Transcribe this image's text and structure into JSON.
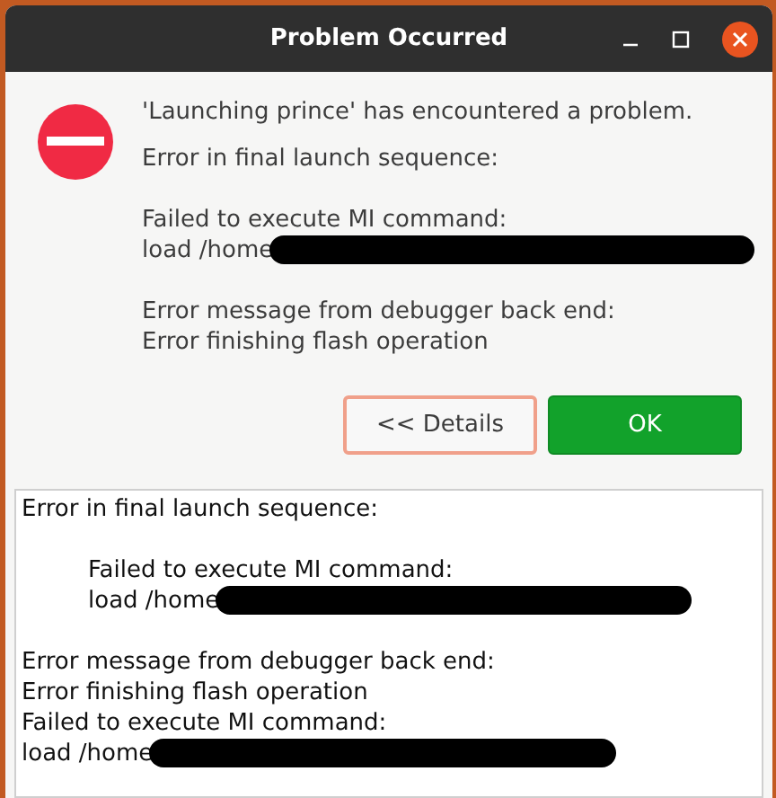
{
  "window": {
    "title": "Problem Occurred"
  },
  "message": {
    "headline": "'Launching prince' has encountered a problem.",
    "paragraphs": [
      {
        "lines": [
          {
            "text": "Error in final launch sequence:",
            "redacted": false
          }
        ]
      },
      {
        "lines": [
          {
            "text": "Failed to execute MI command:",
            "redacted": false
          },
          {
            "text": "load /home",
            "redacted": true
          }
        ]
      },
      {
        "lines": [
          {
            "text": "Error message from debugger back end:",
            "redacted": false
          },
          {
            "text": "Error finishing flash operation",
            "redacted": false
          }
        ]
      }
    ]
  },
  "buttons": [
    {
      "label": "<< Details",
      "kind": "secondary"
    },
    {
      "label": "OK",
      "kind": "primary"
    }
  ],
  "details": {
    "paragraphs": [
      {
        "indented": false,
        "lines": [
          {
            "text": "Error in final launch sequence:",
            "redacted": false
          }
        ]
      },
      {
        "indented": true,
        "lines": [
          {
            "text": "Failed to execute MI command:",
            "redacted": false
          },
          {
            "text": "load /home",
            "redacted": true
          }
        ]
      },
      {
        "indented": false,
        "lines": [
          {
            "text": "Error message from debugger back end:",
            "redacted": false
          },
          {
            "text": "Error finishing flash operation",
            "redacted": false
          },
          {
            "text": "Failed to execute MI command:",
            "redacted": false
          },
          {
            "text": "load /home",
            "redacted": true
          }
        ]
      }
    ]
  }
}
